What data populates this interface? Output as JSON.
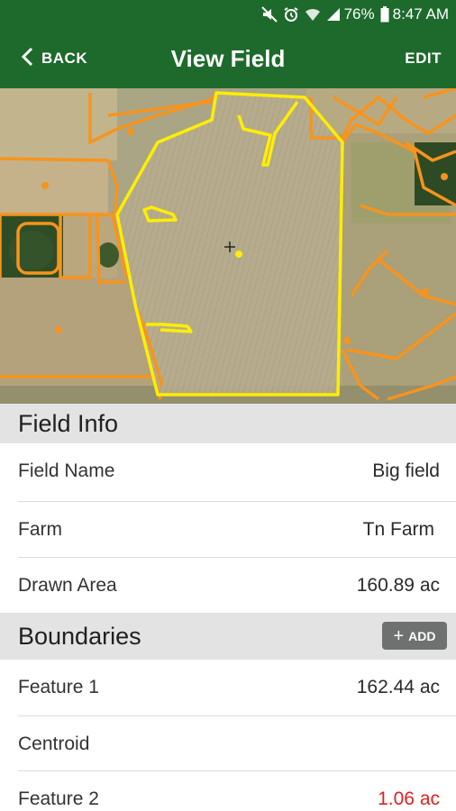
{
  "status_bar": {
    "battery": "76%",
    "time": "8:47 AM",
    "icons": [
      "mute-icon",
      "alarm-icon",
      "wifi-icon",
      "signal-icon",
      "battery-icon"
    ]
  },
  "app_bar": {
    "back_label": "BACK",
    "title": "View Field",
    "edit_label": "EDIT",
    "background": "#1e6a2c"
  },
  "map": {
    "boundary_color": "#f7941d",
    "selected_color": "#ffee00"
  },
  "field_info": {
    "title": "Field Info",
    "rows": [
      {
        "label": "Field Name",
        "value": "Big field"
      },
      {
        "label": "Farm",
        "value": "Tn Farm"
      },
      {
        "label": "Drawn Area",
        "value": "160.89 ac"
      }
    ]
  },
  "boundaries": {
    "title": "Boundaries",
    "add_label": "ADD",
    "rows": [
      {
        "label": "Feature 1",
        "value": "162.44 ac"
      },
      {
        "label": "Centroid",
        "value": ""
      },
      {
        "label": "Feature 2",
        "value": "1.06 ac",
        "value_color": "#e02020"
      }
    ]
  }
}
